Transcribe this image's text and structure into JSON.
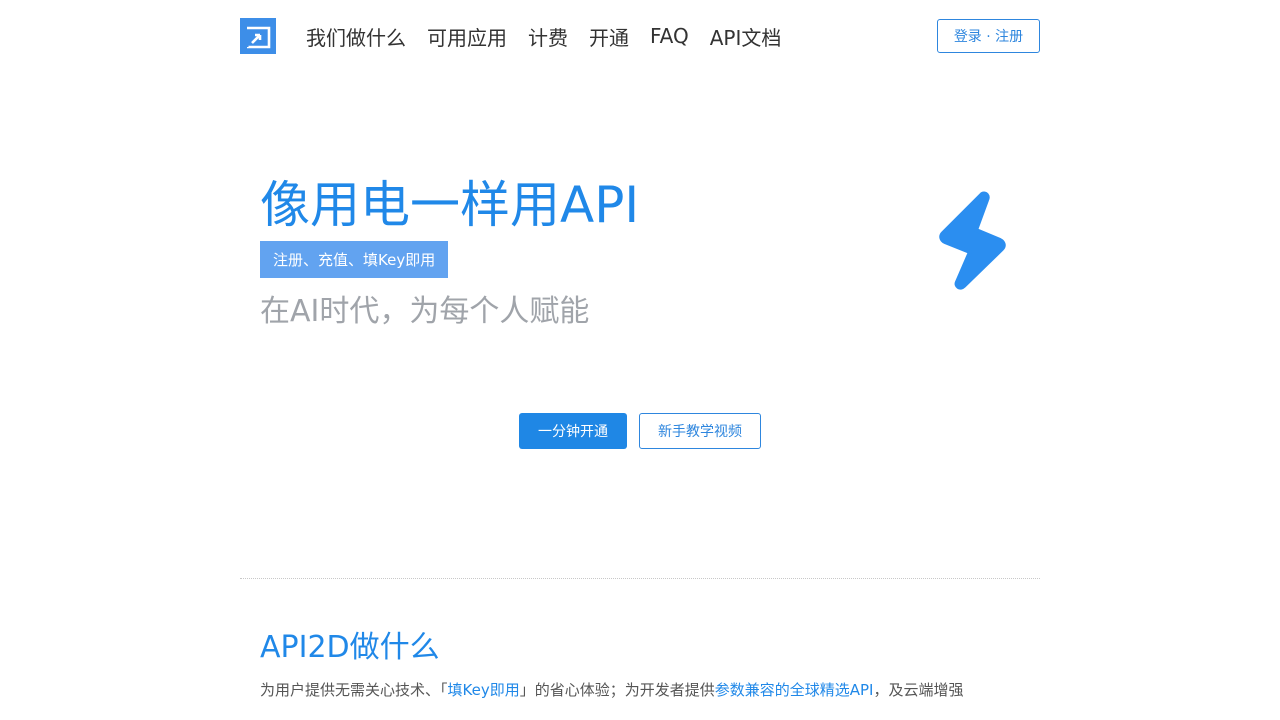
{
  "header": {
    "logo_icon": "api2d-logo-icon",
    "nav": [
      {
        "label": "我们做什么"
      },
      {
        "label": "可用应用"
      },
      {
        "label": "计费"
      },
      {
        "label": "开通"
      },
      {
        "label": "FAQ"
      },
      {
        "label": "API文档"
      }
    ],
    "login_label": "登录 · 注册"
  },
  "hero": {
    "title": "像用电一样用API",
    "tag": "注册、充值、填Key即用",
    "subtitle": "在AI时代，为每个人赋能",
    "icon": "lightning-bolt-icon",
    "primary_button": "一分钟开通",
    "secondary_button": "新手教学视频"
  },
  "section": {
    "title": "API2D做什么",
    "text_1": "为用户提供无需关心技术、「",
    "text_hl_1": "填Key即用",
    "text_2": "」的省心体验；为开发者提供",
    "text_hl_2": "参数兼容的全球精选API",
    "text_3": "，及云端增强"
  },
  "colors": {
    "brand_blue": "#2088e8",
    "tag_blue": "#62a3f0",
    "subtitle_gray": "#a0a4aa"
  }
}
